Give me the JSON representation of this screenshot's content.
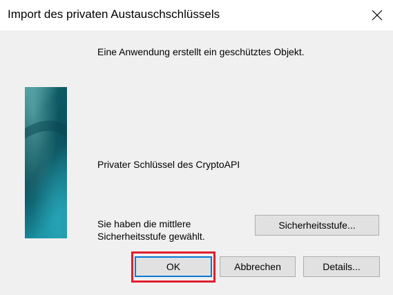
{
  "window": {
    "title": "Import des privaten Austauschschlüssels"
  },
  "content": {
    "message": "Eine Anwendung erstellt ein geschütztes Objekt.",
    "key_name": "Privater Schlüssel des CryptoAPI",
    "security_line1": "Sie haben die mittlere",
    "security_line2": "Sicherheitsstufe gewählt."
  },
  "buttons": {
    "security_level": "Sicherheitsstufe...",
    "ok": "OK",
    "cancel": "Abbrechen",
    "details": "Details..."
  },
  "icons": {
    "close": "close-icon"
  },
  "colors": {
    "focus_border": "#0078d7",
    "highlight_border": "#e01e2d",
    "side_image_dark": "#0b4a55",
    "side_image_light": "#1a8b9c"
  }
}
